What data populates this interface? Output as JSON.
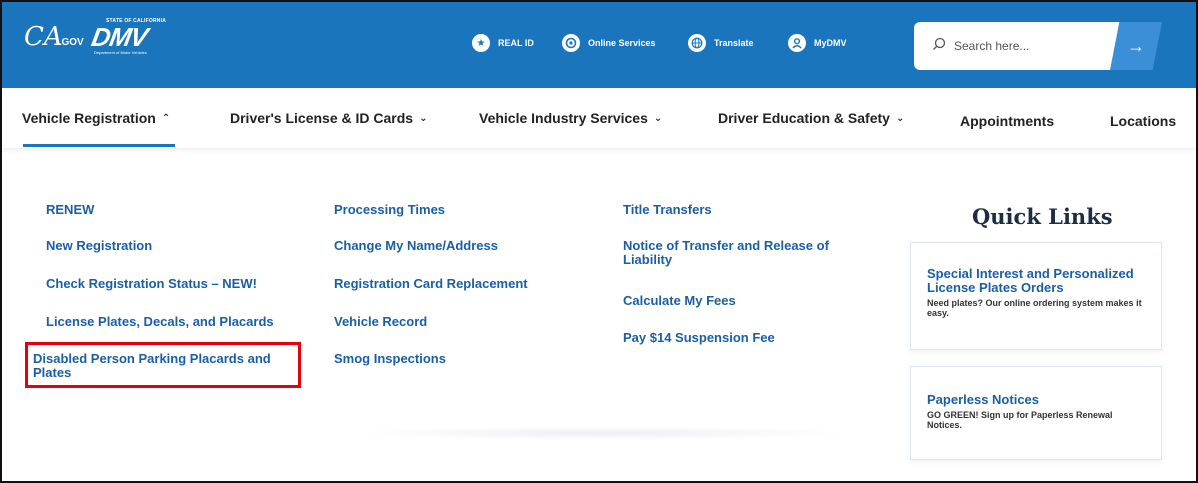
{
  "header": {
    "logo_ca": "CA",
    "logo_ca_sub": ".GOV",
    "logo_state": "STATE OF CALIFORNIA",
    "logo_dmv": "DMV",
    "logo_dept": "Department of Motor Vehicles",
    "utilities": [
      {
        "label": "REAL ID",
        "icon": "star-icon"
      },
      {
        "label": "Online Services",
        "icon": "online-services-icon"
      },
      {
        "label": "Translate",
        "icon": "globe-icon"
      },
      {
        "label": "MyDMV",
        "icon": "user-icon"
      }
    ],
    "search": {
      "placeholder": "Search here...",
      "button_icon": "→"
    },
    "brand_color": "#1b75bc"
  },
  "nav": {
    "items": [
      {
        "label": "Vehicle Registration",
        "chevron": "⌃",
        "active": true
      },
      {
        "label": "Driver's License & ID Cards",
        "chevron": "⌄"
      },
      {
        "label": "Vehicle Industry Services",
        "chevron": "⌄"
      },
      {
        "label": "Driver Education & Safety",
        "chevron": "⌄"
      },
      {
        "label": "Appointments"
      },
      {
        "label": "Locations"
      }
    ]
  },
  "menu": {
    "col1": [
      "RENEW",
      "New Registration",
      "Check Registration Status – NEW!",
      "License Plates, Decals, and Placards",
      "Disabled Person Parking Placards and Plates"
    ],
    "col2": [
      "Processing Times",
      "Change My Name/Address",
      "Registration Card Replacement",
      "Vehicle Record",
      "Smog Inspections"
    ],
    "col3": [
      "Title Transfers",
      "Notice of Transfer and Release of Liability",
      "Calculate My Fees",
      "Pay $14 Suspension Fee"
    ]
  },
  "quick_links": {
    "title": "Quick Links",
    "cards": [
      {
        "title": "Special Interest and Personalized License Plates Orders",
        "desc": "Need plates? Our online ordering system makes it easy."
      },
      {
        "title": "Paperless Notices",
        "desc": "GO GREEN! Sign up for Paperless Renewal Notices."
      }
    ]
  },
  "highlight_color": "#e3000f"
}
